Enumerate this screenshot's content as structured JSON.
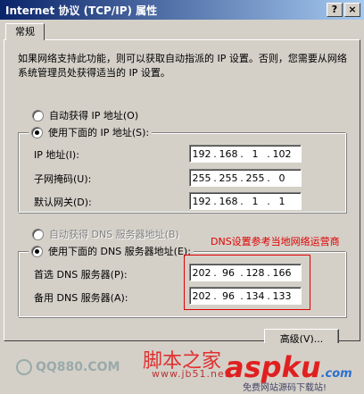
{
  "window": {
    "title": "Internet 协议 (TCP/IP) 属性",
    "help": "?",
    "close": "×"
  },
  "tab": {
    "general": "常规"
  },
  "description": "如果网络支持此功能，则可以获取自动指派的 IP 设置。否则，您需要从网络系统管理员处获得适当的 IP 设置。",
  "ip_section": {
    "auto_label": "自动获得 IP 地址(O)",
    "manual_label": "使用下面的 IP 地址(S):",
    "fields": [
      {
        "label": "IP 地址(I):",
        "octets": [
          "192",
          "168",
          "1",
          "102"
        ]
      },
      {
        "label": "子网掩码(U):",
        "octets": [
          "255",
          "255",
          "255",
          "0"
        ]
      },
      {
        "label": "默认网关(D):",
        "octets": [
          "192",
          "168",
          "1",
          "1"
        ]
      }
    ]
  },
  "dns_section": {
    "auto_label": "自动获得 DNS 服务器地址(B)",
    "manual_label": "使用下面的 DNS 服务器地址(E):",
    "annotation": "DNS设置参考当地网络运营商",
    "fields": [
      {
        "label": "首选 DNS 服务器(P):",
        "octets": [
          "202",
          "96",
          "128",
          "166"
        ]
      },
      {
        "label": "备用 DNS 服务器(A):",
        "octets": [
          "202",
          "96",
          "134",
          "133"
        ]
      }
    ]
  },
  "advanced_button": "高级(V)...",
  "watermarks": {
    "left": "QQ880.COM",
    "center_title": "脚本之家",
    "center_url": "www.jb51.net",
    "logo": "aspku",
    "logo_suffix": ".com",
    "sub": "免费网站源码下载站!"
  },
  "colors": {
    "annotation": "#e00000",
    "title_start": "#0a246a",
    "title_end": "#a6caf0"
  }
}
